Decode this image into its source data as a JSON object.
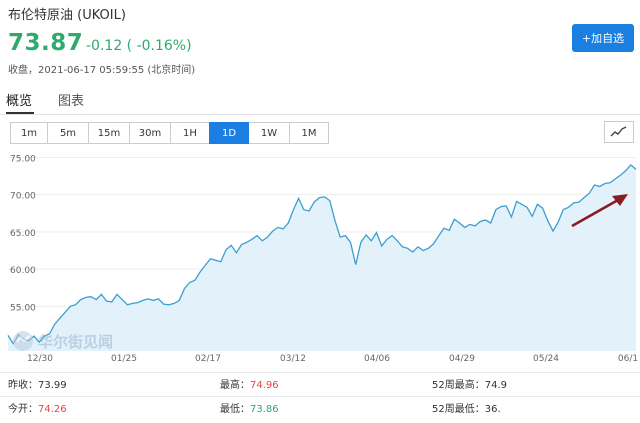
{
  "header": {
    "title": "布伦特原油 (UKOIL)",
    "price": "73.87",
    "change": "-0.12 ( -0.16%)",
    "status": "收盘，2021-06-17 05:59:55 (北京时间)",
    "add_label": "+加自选"
  },
  "tabs": [
    {
      "label": "概览"
    },
    {
      "label": "图表"
    }
  ],
  "periods": [
    "1m",
    "5m",
    "15m",
    "30m",
    "1H",
    "1D",
    "1W",
    "1M"
  ],
  "active_period": "1D",
  "chart_data": {
    "type": "area",
    "ylim": [
      49,
      76
    ],
    "yticks": [
      "75.00",
      "70.00",
      "65.00",
      "60.00",
      "55.00"
    ],
    "ytick_values": [
      75,
      70,
      65,
      60,
      55
    ],
    "xticks": [
      "12/30",
      "01/25",
      "02/17",
      "03/12",
      "04/06",
      "04/29",
      "05/24",
      "06/1"
    ],
    "values": [
      51.1,
      50.0,
      51.2,
      50.6,
      50.4,
      51.0,
      50.2,
      51.0,
      51.3,
      52.6,
      53.4,
      54.2,
      55.0,
      55.2,
      55.9,
      56.2,
      56.3,
      55.9,
      56.6,
      55.7,
      55.6,
      56.6,
      55.9,
      55.2,
      55.4,
      55.5,
      55.8,
      56.0,
      55.8,
      56.0,
      55.3,
      55.2,
      55.4,
      55.8,
      57.4,
      58.2,
      58.5,
      59.6,
      60.5,
      61.4,
      61.2,
      61.0,
      62.6,
      63.2,
      62.2,
      63.3,
      63.6,
      64.0,
      64.5,
      63.8,
      64.3,
      65.1,
      65.6,
      65.4,
      66.2,
      68.0,
      69.5,
      68.0,
      67.8,
      69.0,
      69.6,
      69.7,
      69.2,
      66.5,
      64.3,
      64.5,
      63.6,
      60.6,
      63.6,
      64.6,
      63.8,
      64.9,
      63.1,
      64.0,
      64.5,
      63.8,
      63.0,
      62.8,
      62.3,
      63.0,
      62.5,
      62.8,
      63.4,
      64.5,
      65.5,
      65.2,
      66.7,
      66.2,
      65.6,
      66.0,
      65.8,
      66.4,
      66.6,
      66.2,
      68.0,
      68.4,
      68.5,
      67.0,
      69.1,
      68.7,
      68.3,
      67.1,
      68.7,
      68.2,
      66.5,
      65.1,
      66.3,
      68.0,
      68.3,
      68.9,
      69.0,
      69.6,
      70.2,
      71.3,
      71.1,
      71.5,
      71.6,
      72.1,
      72.6,
      73.2,
      74.0,
      73.4
    ],
    "series_color": "#3ba0d0",
    "fill_color": "#e3f1fb",
    "grid": true
  },
  "stats": [
    [
      {
        "label": "昨收",
        "value": "73.99",
        "color": "#333333"
      },
      {
        "label": "最高",
        "value": "74.96",
        "color": "#e84545"
      },
      {
        "label": "52周最高",
        "value": "74.9",
        "color": "#333333"
      }
    ],
    [
      {
        "label": "今开",
        "value": "74.26",
        "color": "#e84545"
      },
      {
        "label": "最低",
        "value": "73.86",
        "color": "#2eaa6e"
      },
      {
        "label": "52周最低",
        "value": "36.",
        "color": "#333333"
      }
    ]
  ],
  "watermark": "华尔街见闻",
  "colors": {
    "accent": "#1a7fe0",
    "down": "#2eaa6e",
    "up": "#e84545",
    "arrow": "#8b1a22"
  }
}
